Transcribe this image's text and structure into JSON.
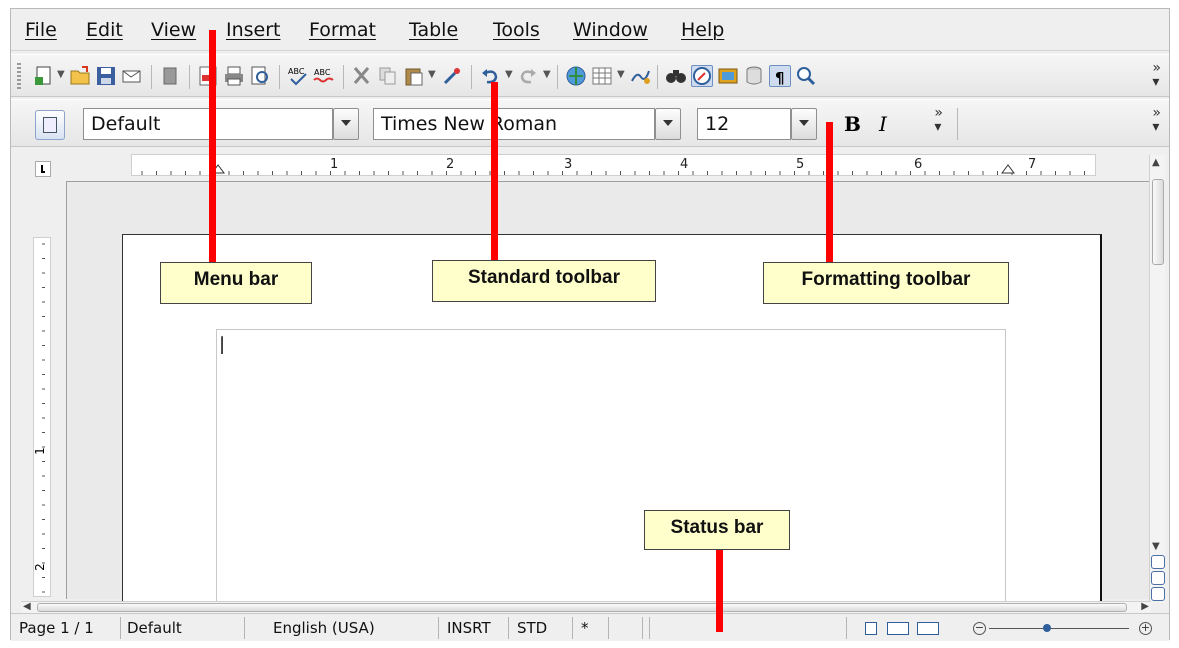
{
  "menubar": {
    "items": [
      "File",
      "Edit",
      "View",
      "Insert",
      "Format",
      "Table",
      "Tools",
      "Window",
      "Help"
    ]
  },
  "formatting": {
    "paragraph_style": "Default",
    "font_name": "Times New Roman",
    "font_size": "12",
    "bold_label": "B",
    "italic_label": "I"
  },
  "ruler": {
    "horizontal_ticks": [
      "1",
      "2",
      "3",
      "4",
      "5",
      "6",
      "7"
    ],
    "vertical_ticks": [
      "1",
      "2"
    ]
  },
  "statusbar": {
    "page": "Page 1 / 1",
    "page_style": "Default",
    "language": "English (USA)",
    "insert_mode": "INSRT",
    "selection_mode": "STD",
    "modified": "*"
  },
  "annotations": {
    "menu_bar": "Menu bar",
    "standard_toolbar": "Standard toolbar",
    "formatting_toolbar": "Formatting toolbar",
    "status_bar": "Status bar"
  },
  "colors": {
    "annotation_line": "#ff0000",
    "callout_bg": "#ffffcc",
    "accent": "#2f5f9a"
  },
  "icons": [
    "new-document-icon",
    "open-folder-icon",
    "save-icon",
    "email-icon",
    "edit-file-icon",
    "export-pdf-icon",
    "print-icon",
    "print-preview-icon",
    "spellcheck-icon",
    "autospellcheck-icon",
    "cut-icon",
    "copy-icon",
    "paste-icon",
    "clone-formatting-icon",
    "undo-icon",
    "redo-icon",
    "hyperlink-icon",
    "table-icon",
    "draw-functions-icon",
    "find-replace-icon",
    "navigator-icon",
    "gallery-icon",
    "data-sources-icon",
    "formatting-marks-icon",
    "zoom-icon"
  ]
}
